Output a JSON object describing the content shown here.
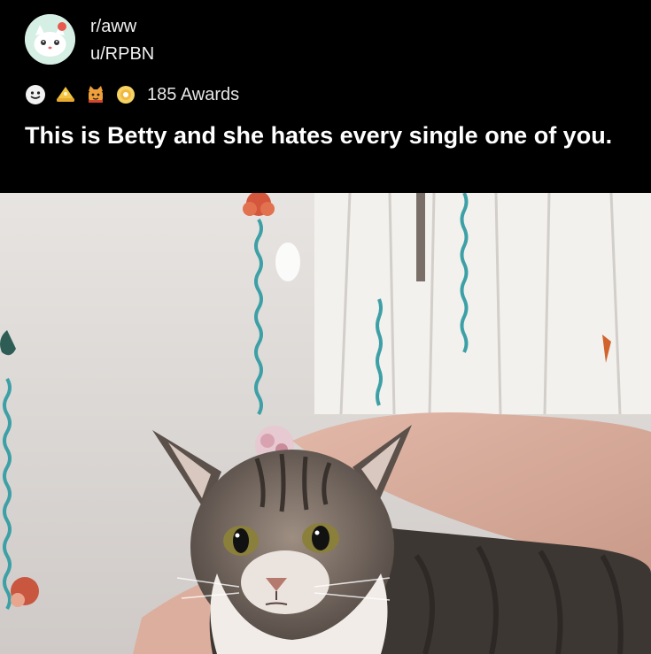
{
  "post": {
    "subreddit": "r/aww",
    "username": "u/RPBN",
    "awards_label": "185 Awards",
    "title": "This is Betty and she hates every single one of you.",
    "awards": [
      "wholesome-award-icon",
      "gold-hat-award-icon",
      "cat-award-icon",
      "sun-award-icon"
    ]
  },
  "image": {
    "subject": "photo-of-cat"
  },
  "colors": {
    "background": "#000000",
    "avatar_bg": "#d8eee2",
    "text": "#ffffff"
  }
}
